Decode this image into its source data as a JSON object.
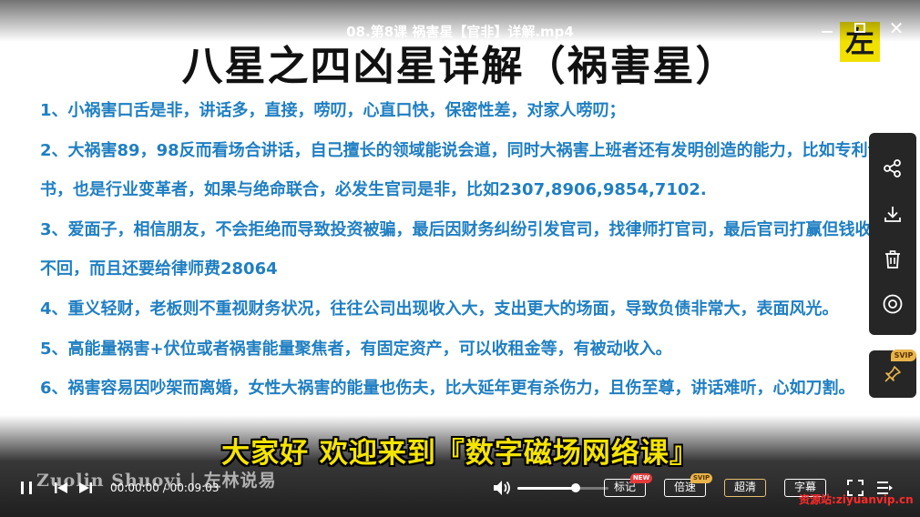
{
  "player": {
    "file_title": "08.第8课 祸害星【官非】详解.mp4",
    "logo_char": "左"
  },
  "slide": {
    "title": "八星之四凶星详解（祸害星）",
    "lines": [
      "1、小祸害口舌是非，讲话多，直接，唠叨，心直口快，保密性差，对家人唠叨；",
      "2、大祸害89，98反而看场合讲话，自己擅长的领域能说会道，同时大祸害上班者还有发明创造的能力，比如专利证",
      "书，也是行业变革者，如果与绝命联合，必发生官司是非，比如2307,8906,9854,7102.",
      "3、爱面子，相信朋友，不会拒绝而导致投资被骗，最后因财务纠纷引发官司，找律师打官司，最后官司打赢但钱收",
      "不回，而且还要给律师费28064",
      "4、重义轻财，老板则不重视财务状况，往往公司出现收入大，支出更大的场面，导致负债非常大，表面风光。",
      "5、高能量祸害+伏位或者祸害能量聚焦者，有固定资产，可以收租金等，有被动收入。",
      "6、祸害容易因吵架而离婚，女性大祸害的能量也伤夫，比大延年更有杀伤力，且伤至尊，讲话难听，心如刀割。"
    ],
    "subtitle": "大家好 欢迎来到『数字磁场网络课』",
    "watermark": "Zuolin Shuoyi | 左林说易"
  },
  "side_panel": {
    "icons": [
      "share-icon",
      "download-icon",
      "trash-icon",
      "eye-icon"
    ],
    "pin_icon": "pin-icon",
    "pin_tag": "SVIP"
  },
  "controls": {
    "time_current": "00:00:00",
    "time_sep": " / ",
    "time_total": "00:09:03",
    "volume_level": 0.64,
    "mark_label": "标记",
    "mark_tag": "NEW",
    "speed_label": "倍速",
    "speed_tag": "SVIP",
    "quality_label": "超清",
    "subtitle_label": "字幕",
    "site_watermark": "资源站:ziyuanvip.cn"
  },
  "colors": {
    "slide_text": "#1f7fc2",
    "subtitle": "#f5e400",
    "logo_bg": "#f2e100",
    "svip_gold": "#e8b44a",
    "new_red": "#e63b3b",
    "site_watermark": "#ff2a2a"
  }
}
